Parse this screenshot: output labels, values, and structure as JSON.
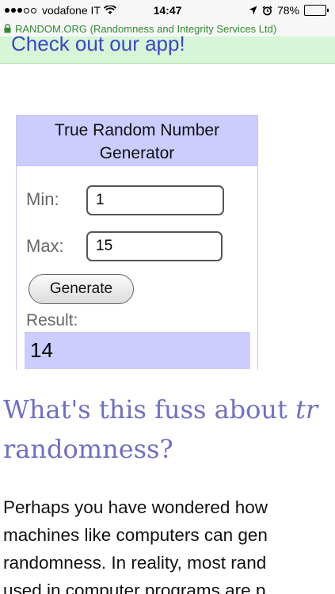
{
  "status_bar": {
    "carrier": "vodafone IT",
    "time": "14:47",
    "battery_percent": "78%",
    "battery_level": 0.78,
    "icons": [
      "signal-dots-icon",
      "wifi-icon",
      "location-arrow-icon",
      "alarm-clock-icon",
      "battery-icon"
    ]
  },
  "browser": {
    "url_text": "RANDOM.ORG (Randomness and Integrity Services Ltd)",
    "url_color": "#2f8a2f"
  },
  "banner": {
    "text": "Check out our app!",
    "background": "#d7f5d7"
  },
  "widget": {
    "title_line1": "True Random Number",
    "title_line2": "Generator",
    "min_label": "Min:",
    "min_value": "1",
    "max_label": "Max:",
    "max_value": "15",
    "generate_label": "Generate",
    "result_label": "Result:",
    "result_value": "14",
    "accent_color": "#ccccff"
  },
  "article": {
    "heading_line1_start": "What's this fuss about ",
    "heading_line1_italic": "tr",
    "heading_line2": "randomness?",
    "heading_color": "#6f6fc4",
    "body_lines": [
      "Perhaps you have wondered how",
      "machines like computers can gen",
      "randomness. In reality, most rand",
      "used in computer programs are p"
    ]
  }
}
